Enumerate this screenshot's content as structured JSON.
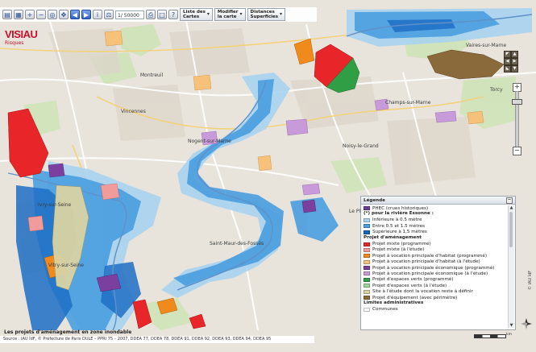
{
  "toolbar": {
    "scale_value": "1/ 50000",
    "menus": [
      {
        "line1": "Liste des",
        "line2": "Cartes"
      },
      {
        "line1": "Modifier",
        "line2": "la carte"
      },
      {
        "line1": "Distances",
        "line2": "Superficies"
      }
    ]
  },
  "logo": {
    "brand": "VISIAU",
    "subtitle": "Risques"
  },
  "places": [
    {
      "name": "Vaires-sur-Marne"
    },
    {
      "name": "Montreuil"
    },
    {
      "name": "Vincennes"
    },
    {
      "name": "Champs-sur-Marne"
    },
    {
      "name": "Torcy"
    },
    {
      "name": "Nogent-sur-Marne"
    },
    {
      "name": "Noisy-le-Grand"
    },
    {
      "name": "Saint-Maur-des-Fossés"
    },
    {
      "name": "Vitry-sur-Seine"
    },
    {
      "name": "Ivry-sur-Seine"
    },
    {
      "name": "Le Pl"
    }
  ],
  "legend": {
    "title": "Légende",
    "items": [
      {
        "kind": "swatch",
        "color": "#6a3f98",
        "label": "PHEC (crues historiques)"
      },
      {
        "kind": "header",
        "label": "(*) pour la rivière Essonne :"
      },
      {
        "kind": "swatch",
        "color": "#a9d3ef",
        "label": "Inférieure à 0.5 mètre"
      },
      {
        "kind": "swatch",
        "color": "#4a9ee0",
        "label": "Entre 0.5 et 1.5 mètres"
      },
      {
        "kind": "swatch",
        "color": "#1565c0",
        "label": "Supérieure à 1,5 mètres"
      },
      {
        "kind": "header",
        "label": "Projet d'aménagement"
      },
      {
        "kind": "swatch",
        "color": "#e8262a",
        "label": "Projet mixte (programmé)"
      },
      {
        "kind": "swatch",
        "color": "#f29b9b",
        "label": "Projet mixte (à l'étude)"
      },
      {
        "kind": "swatch",
        "color": "#f08a1c",
        "label": "Projet à vocation principale d'habitat (programmé)"
      },
      {
        "kind": "swatch",
        "color": "#f6c27a",
        "label": "Projet à vocation principale d'habitat (à l'étude)"
      },
      {
        "kind": "swatch",
        "color": "#7b3fa0",
        "label": "Projet à vocation principale économique (programmé)"
      },
      {
        "kind": "swatch",
        "color": "#c79ad9",
        "label": "Projet à vocation principale économique (à l'étude)"
      },
      {
        "kind": "swatch",
        "color": "#2f9e44",
        "label": "Projet d'espaces verts (programmé)"
      },
      {
        "kind": "swatch",
        "color": "#9fd49a",
        "label": "Projet d'espaces verts (à l'étude)"
      },
      {
        "kind": "swatch",
        "color": "#d9d3a3",
        "label": "Site à l'étude dont la vocation reste à définir"
      },
      {
        "kind": "swatch",
        "color": "#8a6a3a",
        "label": "Projet d'équipement (avec périmètre)"
      },
      {
        "kind": "header",
        "label": "Limites administratives"
      },
      {
        "kind": "swatch",
        "color": "#ffffff",
        "label": "Communes"
      }
    ]
  },
  "caption": "Les projets d'aménagement en zone inondable",
  "status": "Source : IAU îdF, © Préfecture de Paris DULE – PPRI 75 – 2007, DDEA 77, DDEA 78, DDEA 91, DDEA 92, DDEA 93, DDEA 94, DDEA 95",
  "scale_label": "km",
  "copyright": "© IAU îdF"
}
